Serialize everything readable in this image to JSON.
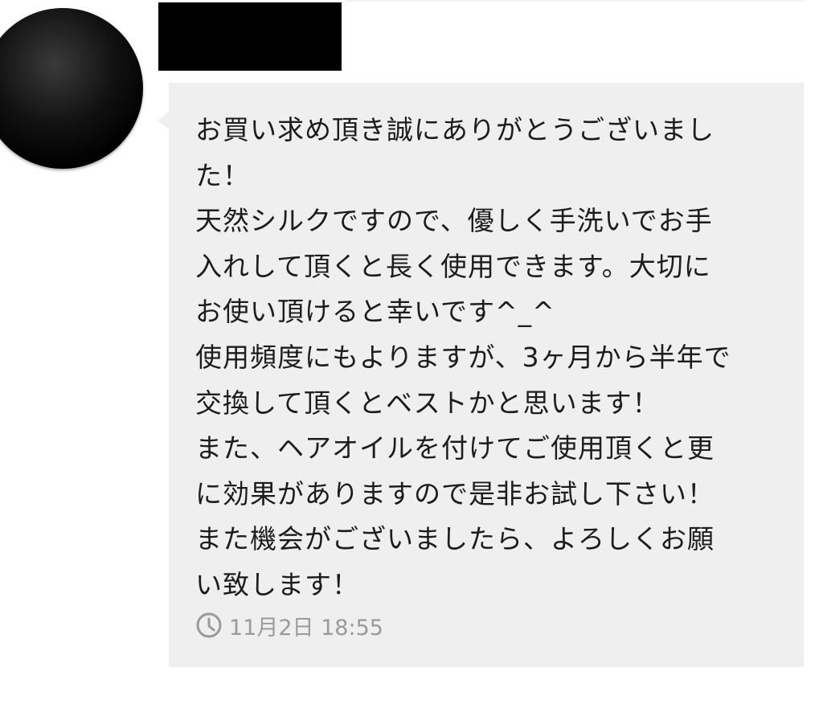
{
  "message": {
    "lines": [
      "お買い求め頂き誠にありがとうございまし",
      "た！",
      "天然シルクですので、優しく手洗いでお手",
      "入れして頂くと長く使用できます。大切に",
      "お使い頂けると幸いです^_^",
      "使用頻度にもよりますが、3ヶ月から半年で",
      "交換して頂くとベストかと思います！",
      "また、ヘアオイルを付けてご使用頂くと更",
      "に効果がありますので是非お試し下さい！",
      "また機会がございましたら、よろしくお願",
      "い致します！"
    ],
    "timestamp": "11月2日 18:55",
    "timestamp_icon": "clock-icon"
  },
  "colors": {
    "bubble": "#efefef",
    "text": "#1c1c1c",
    "timestamp": "#9a9a9a"
  }
}
